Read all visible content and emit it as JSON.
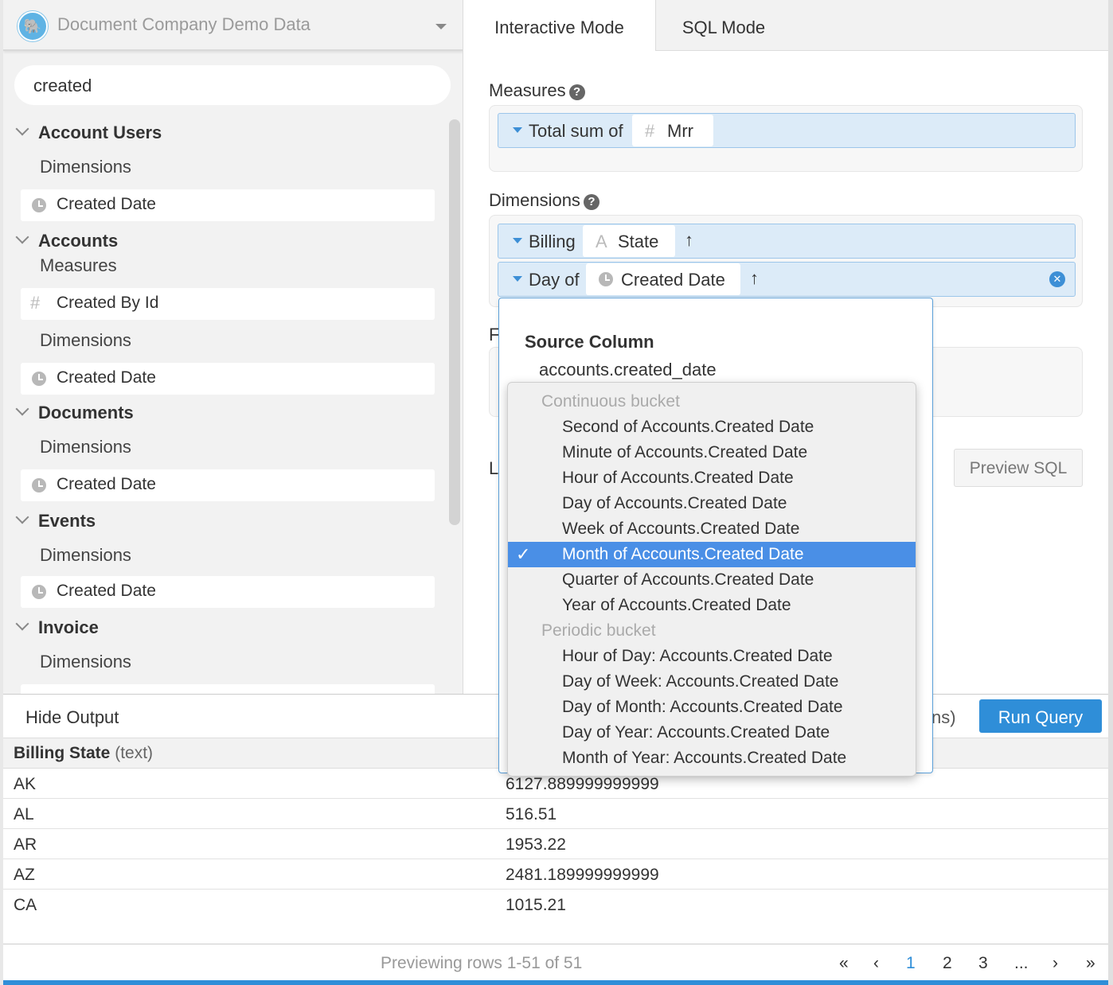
{
  "sidebar": {
    "database": "Document Company Demo Data",
    "search_value": "created",
    "groups": [
      {
        "name": "Account Users",
        "sections": [
          {
            "label": "Dimensions",
            "items": [
              {
                "icon": "clock-icon",
                "label": "Created Date"
              }
            ]
          }
        ]
      },
      {
        "name": "Accounts",
        "sections": [
          {
            "label": "Measures",
            "items": [
              {
                "icon": "hash-icon",
                "label": "Created By Id"
              }
            ]
          },
          {
            "label": "Dimensions",
            "items": [
              {
                "icon": "clock-icon",
                "label": "Created Date"
              }
            ]
          }
        ]
      },
      {
        "name": "Documents",
        "sections": [
          {
            "label": "Dimensions",
            "items": [
              {
                "icon": "clock-icon",
                "label": "Created Date"
              }
            ]
          }
        ]
      },
      {
        "name": "Events",
        "sections": [
          {
            "label": "Dimensions",
            "items": [
              {
                "icon": "clock-icon",
                "label": "Created Date"
              }
            ]
          }
        ]
      },
      {
        "name": "Invoice",
        "sections": [
          {
            "label": "Dimensions",
            "items": []
          }
        ]
      }
    ]
  },
  "tabs": {
    "interactive": "Interactive Mode",
    "sql": "SQL Mode"
  },
  "builder": {
    "measures_label": "Measures",
    "dimensions_label": "Dimensions",
    "filters_label_fragment": "F",
    "limit_label_fragment": "L",
    "measure": {
      "prefix": "Total sum of",
      "icon": "hash-icon",
      "field": "Mrr"
    },
    "dimensions": [
      {
        "prefix": "Billing",
        "icon": "text-icon",
        "field": "State",
        "sort": "↑"
      },
      {
        "prefix": "Day of",
        "icon": "clock-icon",
        "field": "Created Date",
        "sort": "↑"
      }
    ],
    "preview_sql": "Preview SQL"
  },
  "popover": {
    "title": "Source Column",
    "source": "accounts.created_date",
    "menu": [
      {
        "type": "header",
        "label": "Continuous bucket"
      },
      {
        "type": "option",
        "label": "Second of Accounts.Created Date"
      },
      {
        "type": "option",
        "label": "Minute of Accounts.Created Date"
      },
      {
        "type": "option",
        "label": "Hour of Accounts.Created Date"
      },
      {
        "type": "option",
        "label": "Day of Accounts.Created Date"
      },
      {
        "type": "option",
        "label": "Week of Accounts.Created Date"
      },
      {
        "type": "option",
        "label": "Month of Accounts.Created Date",
        "selected": true
      },
      {
        "type": "option",
        "label": "Quarter of Accounts.Created Date"
      },
      {
        "type": "option",
        "label": "Year of Accounts.Created Date"
      },
      {
        "type": "header",
        "label": "Periodic bucket"
      },
      {
        "type": "option",
        "label": "Hour of Day: Accounts.Created Date"
      },
      {
        "type": "option",
        "label": "Day of Week: Accounts.Created Date"
      },
      {
        "type": "option",
        "label": "Day of Month: Accounts.Created Date"
      },
      {
        "type": "option",
        "label": "Day of Year: Accounts.Created Date"
      },
      {
        "type": "option",
        "label": "Month of Year: Accounts.Created Date"
      }
    ]
  },
  "output": {
    "hide_label": "Hide Output",
    "partial_text": "ns)",
    "run_label": "Run Query",
    "column1": "Billing State",
    "column1_type": "(text)",
    "rows": [
      {
        "state": "AK",
        "value": "6127.889999999999"
      },
      {
        "state": "AL",
        "value": "516.51"
      },
      {
        "state": "AR",
        "value": "1953.22"
      },
      {
        "state": "AZ",
        "value": "2481.189999999999"
      },
      {
        "state": "CA",
        "value": "1015.21"
      }
    ],
    "preview_info": "Previewing rows 1-51 of 51",
    "pager": {
      "first": "«",
      "prev": "‹",
      "pages": [
        "1",
        "2",
        "3"
      ],
      "ellipsis": "...",
      "next": "›",
      "last": "»",
      "current": "1"
    }
  },
  "colors": {
    "accent": "#2f8ed8",
    "selected": "#4a8fe6",
    "pill": "#dcebf8"
  }
}
